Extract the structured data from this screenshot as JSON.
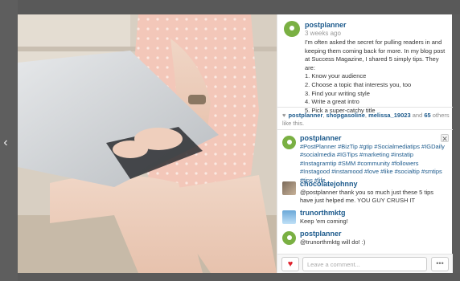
{
  "photo": {
    "subject": "woman-typing-on-laptop"
  },
  "caption": {
    "username": "postplanner",
    "time": "3 weeks ago",
    "lines": [
      "I'm often asked the secret for pulling readers in and keeping them coming back for more. In my blog post at Success Magazine, I shared 5 simply tips. They are:",
      "1. Know your audience",
      "2. Choose a topic that interests you, too",
      "3. Find your writing style",
      "4. Write a great intro",
      "5. Pick a super-catchy title"
    ]
  },
  "likes": {
    "users": [
      "postplanner",
      "shopgasoline",
      "melissa_19023"
    ],
    "and_text": "and",
    "count": "65",
    "suffix": "others like this."
  },
  "comments": [
    {
      "username": "postplanner",
      "text": "#PostPlanner #BizTip #gtip #Socialmediatips #IGDaily #socialmedia #IGTips #marketing #instatip #Instagramtip #SMM #community #followers #Instagood #instamood #love #like #socialtip #smtips #tips #life",
      "avatar": "postplanner-pin"
    },
    {
      "username": "chocolatejohnny",
      "text": "@postplanner thank you so much just these 5 tips have just helped me. YOU GUY CRUSH IT",
      "avatar": "photo"
    },
    {
      "username": "trunorthmktg",
      "text": "Keep 'em coming!",
      "avatar": "sky"
    },
    {
      "username": "postplanner",
      "text": "@trunorthmktg will do! :)",
      "avatar": "postplanner-pin"
    }
  ],
  "footer": {
    "like_icon": "heart",
    "comment_placeholder": "Leave a comment...",
    "more_label": "•••"
  },
  "nav": {
    "prev_icon": "‹"
  },
  "close_icon": "✕"
}
